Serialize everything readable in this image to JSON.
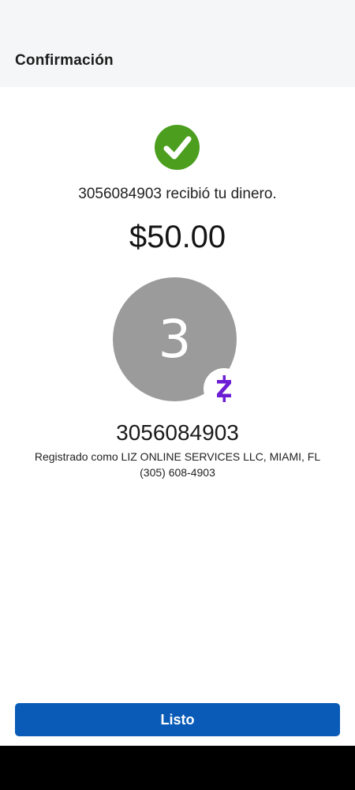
{
  "header": {
    "title": "Confirmación"
  },
  "confirmation": {
    "status_icon": "check-circle-icon",
    "message": "3056084903 recibió tu dinero.",
    "amount": "$50.00"
  },
  "recipient": {
    "avatar_initial": "3",
    "badge_icon": "zelle-logo-icon",
    "name": "3056084903",
    "registered_as": "Registrado como LIZ ONLINE SERVICES LLC, MIAMI, FL",
    "phone": "(305) 608-4903"
  },
  "actions": {
    "done_label": "Listo"
  },
  "colors": {
    "success": "#4b9e1e",
    "primary_button": "#0a5bb7",
    "zelle_purple": "#6d1ed4",
    "avatar_bg": "#9b9b9b",
    "header_bg": "#f5f6f7"
  }
}
